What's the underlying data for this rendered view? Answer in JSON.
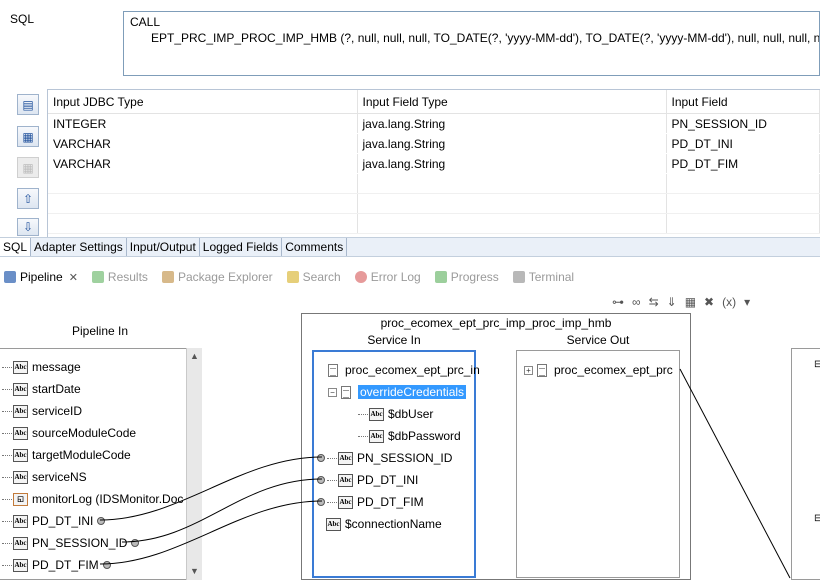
{
  "sql": {
    "label": "SQL",
    "line1": "CALL",
    "line2": "EPT_PRC_IMP_PROC_IMP_HMB (?, null, null, null, TO_DATE(?, 'yyyy-MM-dd'), TO_DATE(?, 'yyyy-MM-dd'), null, null, null, null)"
  },
  "table": {
    "headers": [
      "Input JDBC Type",
      "Input Field Type",
      "Input Field"
    ],
    "rows": [
      [
        "INTEGER",
        "java.lang.String",
        "PN_SESSION_ID"
      ],
      [
        "VARCHAR",
        "java.lang.String",
        "PD_DT_INI"
      ],
      [
        "VARCHAR",
        "java.lang.String",
        "PD_DT_FIM"
      ]
    ]
  },
  "editor_tabs": [
    "SQL",
    "Adapter Settings",
    "Input/Output",
    "Logged Fields",
    "Comments"
  ],
  "view_tabs": [
    "Pipeline",
    "Results",
    "Package Explorer",
    "Search",
    "Error Log",
    "Progress",
    "Terminal"
  ],
  "pipeline": {
    "pipeline_in_title": "Pipeline In",
    "pipeline_in_items": [
      "message",
      "startDate",
      "serviceID",
      "sourceModuleCode",
      "targetModuleCode",
      "serviceNS",
      "monitorLog (IDSMonitor.Doc",
      "PD_DT_INI",
      "PN_SESSION_ID",
      "PD_DT_FIM"
    ],
    "service_name": "proc_ecomex_ept_prc_imp_proc_imp_hmb",
    "service_in_title": "Service In",
    "service_out_title": "Service Out",
    "service_in_root": "proc_ecomex_ept_prc_in",
    "override": "overrideCredentials",
    "db_user": "$dbUser",
    "db_password": "$dbPassword",
    "svc_inputs": [
      "PN_SESSION_ID",
      "PD_DT_INI",
      "PD_DT_FIM"
    ],
    "connection_name": "$connectionName",
    "service_out_root": "proc_ecomex_ept_prc"
  },
  "icons": {
    "abc": "Abc",
    "toolbar": [
      "connect-icon",
      "link-icon",
      "map-icon",
      "tree-icon",
      "delete-icon",
      "variable-icon",
      "dropdown-icon"
    ]
  }
}
